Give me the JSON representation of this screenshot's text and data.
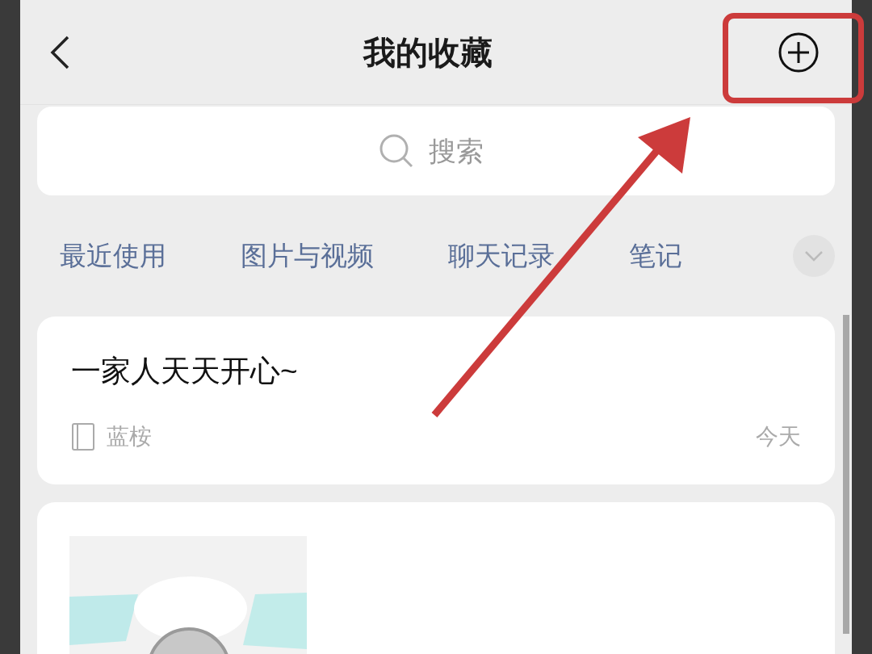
{
  "header": {
    "title": "我的收藏"
  },
  "search": {
    "placeholder": "搜索"
  },
  "categories": [
    "最近使用",
    "图片与视频",
    "聊天记录",
    "笔记"
  ],
  "items": [
    {
      "kind": "note",
      "title": "一家人天天开心~",
      "source": "蓝桉",
      "date": "今天"
    },
    {
      "kind": "video"
    }
  ]
}
